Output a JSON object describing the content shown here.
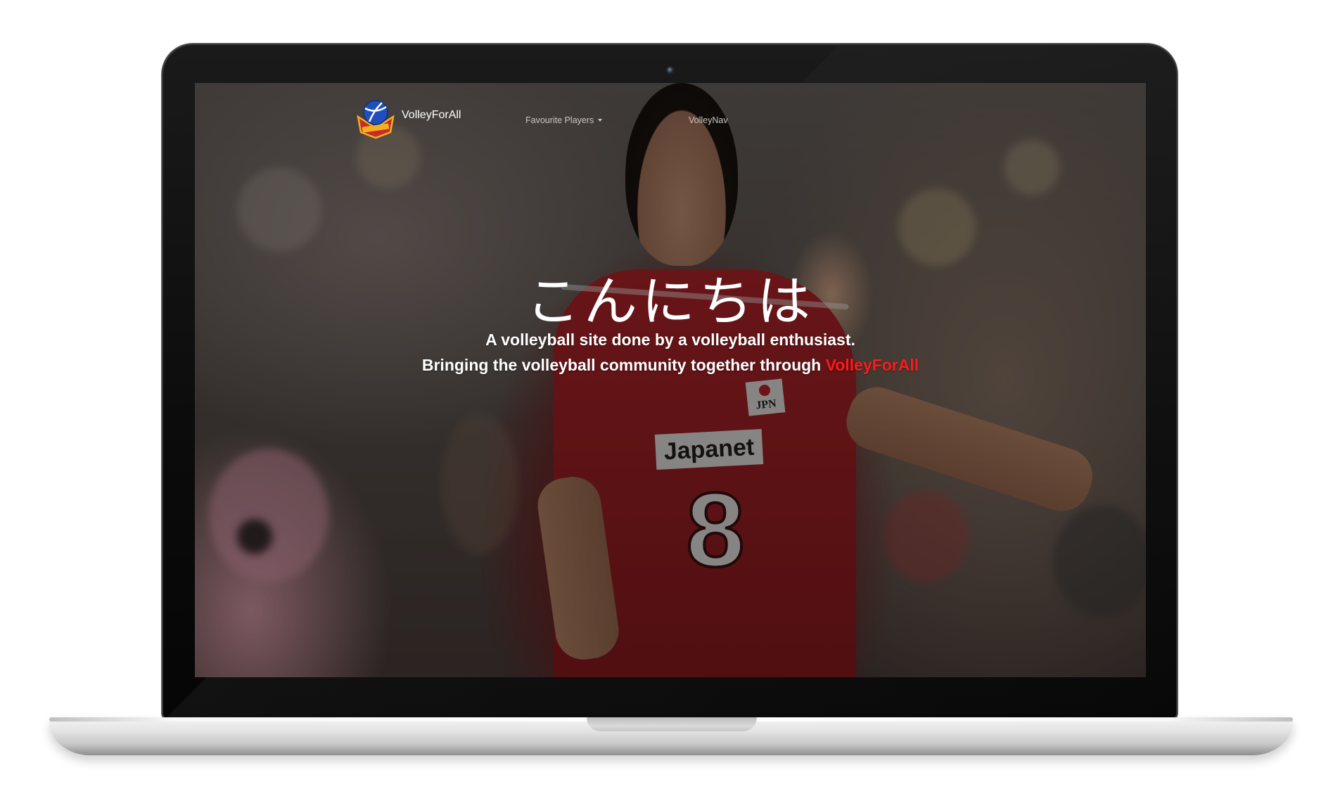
{
  "device": {
    "frame": "laptop-mockup"
  },
  "site": {
    "brand_name": "VolleyForAll",
    "logo_icon": "volleyball-shield-logo-icon",
    "nav": {
      "items": [
        {
          "label": "Favourite Players",
          "has_dropdown": true,
          "dropdown_icon": "caret-down-icon"
        },
        {
          "label": "VolleyNav",
          "has_dropdown": false
        }
      ]
    },
    "hero": {
      "title": "こんにちは",
      "line1": "A volleyball site done by a volleyball enthusiast.",
      "line2_prefix": "Bringing the volleyball community together through ",
      "line2_highlight": "VolleyForAll"
    },
    "background_photo": {
      "sponsor_text": "Japanet",
      "country_patch": "JPN",
      "jersey_number": "8"
    }
  },
  "colors": {
    "highlight": "#ff1a1a",
    "text": "#ffffff",
    "nav_text": "#c9c6c4",
    "jersey_red": "#b4252a"
  }
}
